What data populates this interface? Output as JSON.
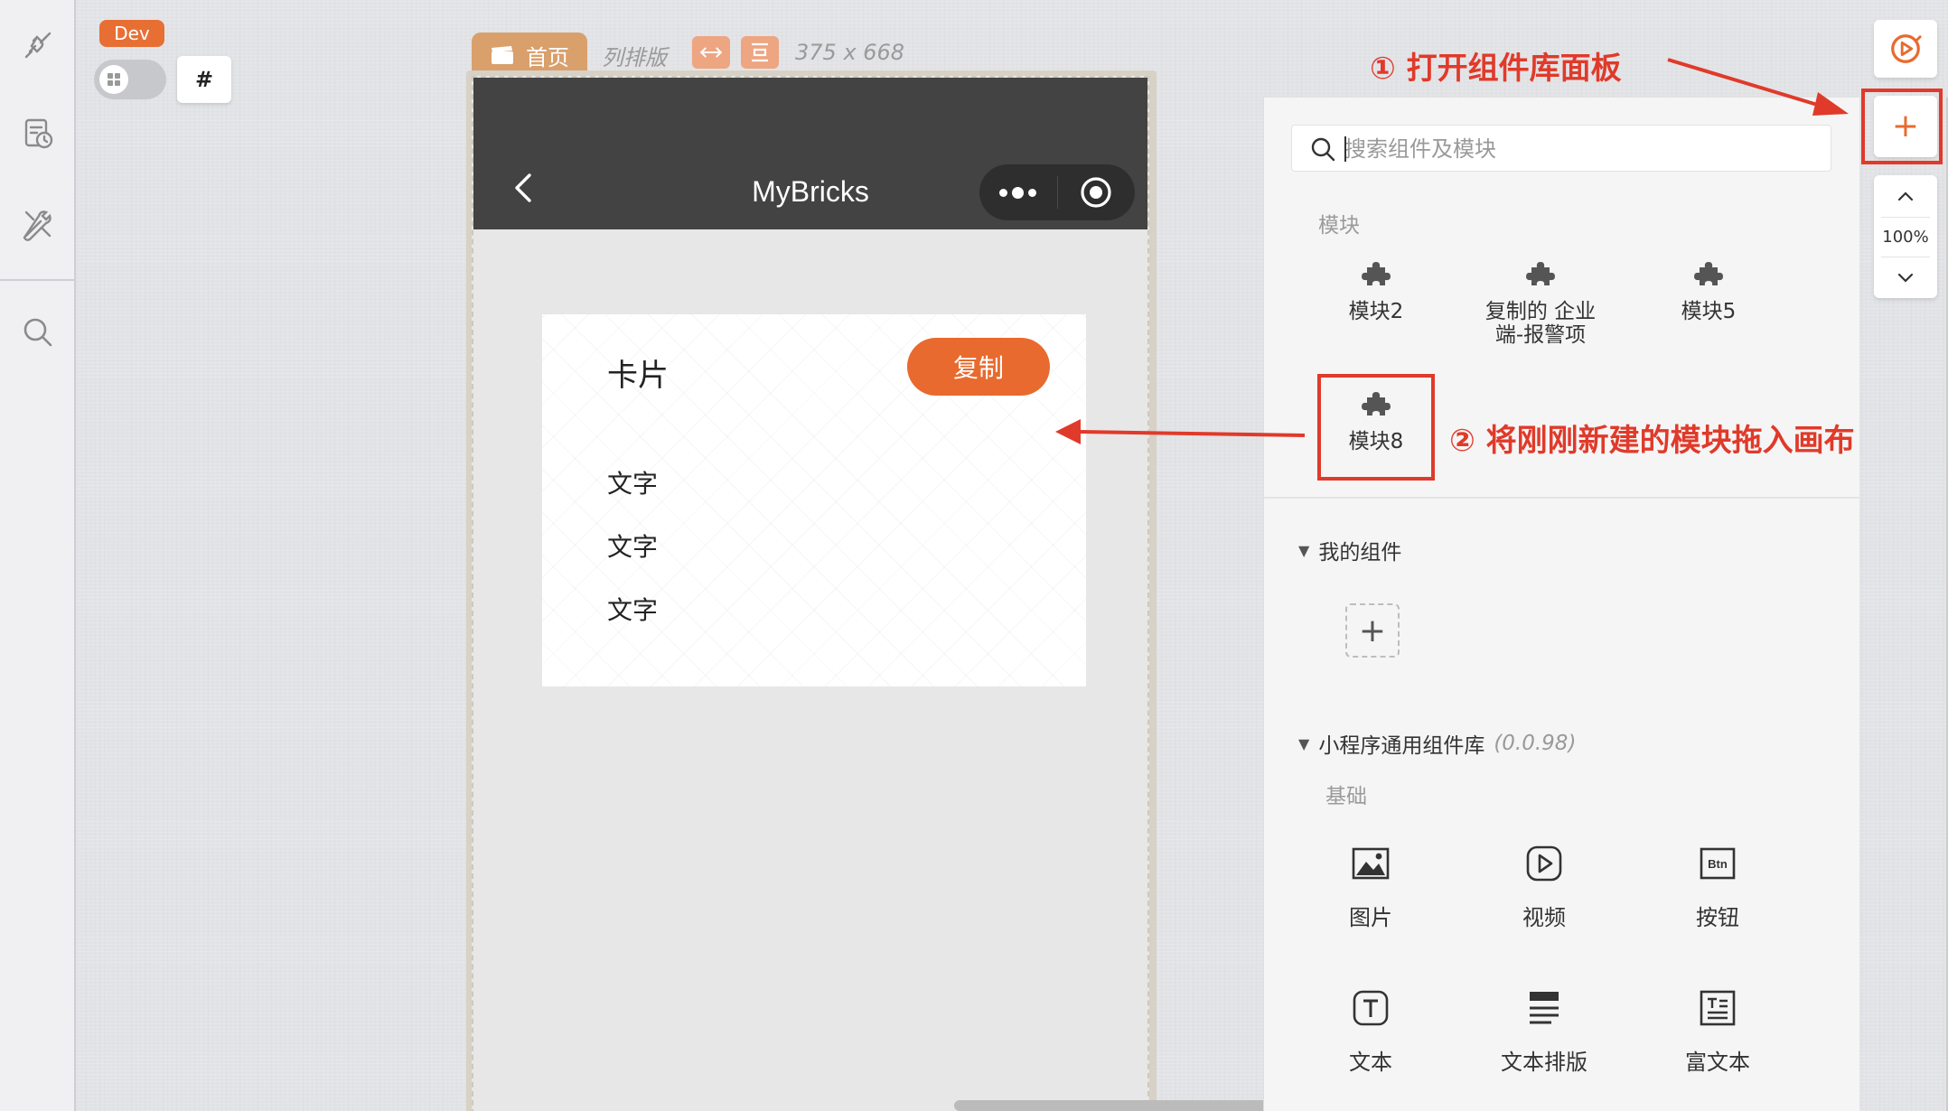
{
  "dev": {
    "badge": "Dev",
    "hash_label": "#"
  },
  "canvas": {
    "page_tab_label": "首页",
    "layout_label": "列排版",
    "size_label": "375 x 668"
  },
  "phone": {
    "nav_title": "MyBricks",
    "card": {
      "title": "卡片",
      "button_label": "复制",
      "texts": [
        "文字",
        "文字",
        "文字"
      ]
    }
  },
  "panel": {
    "search_placeholder": "搜索组件及模块",
    "modules_label": "模块",
    "modules": [
      {
        "label": "模块2"
      },
      {
        "label": "复制的 企业端-报警项",
        "line1": "复制的 企业",
        "line2": "端-报警项"
      },
      {
        "label": "模块5"
      },
      {
        "label": "模块8"
      }
    ],
    "my_components_title": "我的组件",
    "add_label": "+",
    "library": {
      "title": "小程序通用组件库",
      "version": "(0.0.98)",
      "basic_label": "基础",
      "items": [
        {
          "label": "图片",
          "icon": "image-icon"
        },
        {
          "label": "视频",
          "icon": "video-icon"
        },
        {
          "label": "按钮",
          "icon": "button-icon"
        },
        {
          "label": "文本",
          "icon": "text-icon"
        },
        {
          "label": "文本排版",
          "icon": "text-layout-icon"
        },
        {
          "label": "富文本",
          "icon": "rich-text-icon"
        }
      ]
    }
  },
  "toolbar": {
    "zoom_value": "100%",
    "add_label": "+"
  },
  "annotations": {
    "step1": "① 打开组件库面板",
    "step2": "② 将刚刚新建的模块拖入画布"
  },
  "colors": {
    "accent": "#e86a2e",
    "annotation": "#e03a2a",
    "navbar": "#434343",
    "page_tab": "#d9a06c"
  }
}
